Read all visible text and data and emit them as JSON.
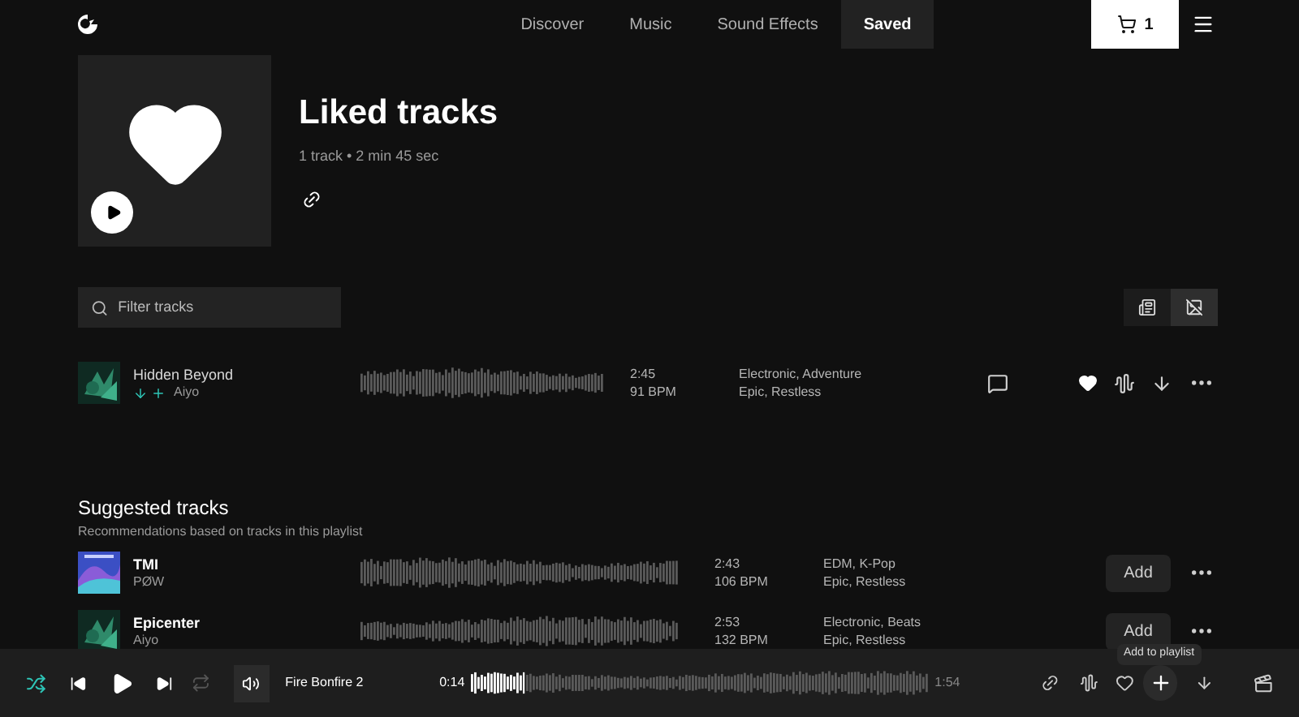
{
  "nav": {
    "items": [
      {
        "label": "Discover",
        "selected": false
      },
      {
        "label": "Music",
        "selected": false
      },
      {
        "label": "Sound Effects",
        "selected": false
      },
      {
        "label": "Saved",
        "selected": true
      }
    ],
    "cart_count": "1"
  },
  "playlist": {
    "title": "Liked tracks",
    "meta": "1 track • 2 min 45 sec"
  },
  "filter": {
    "placeholder": "Filter tracks"
  },
  "view_toggles": [
    {
      "selected": false
    },
    {
      "selected": true
    }
  ],
  "tracks": [
    {
      "title": "Hidden Beyond",
      "artist": "Aiyo",
      "duration": "2:45",
      "bpm": "91 BPM",
      "genres": "Electronic, Adventure",
      "moods": "Epic, Restless",
      "liked": true
    }
  ],
  "suggested": {
    "title": "Suggested tracks",
    "subtitle": "Recommendations based on tracks in this playlist",
    "tracks": [
      {
        "title": "TMI",
        "artist": "PØW",
        "duration": "2:43",
        "bpm": "106 BPM",
        "genres": "EDM, K-Pop",
        "moods": "Epic, Restless",
        "button": "Add"
      },
      {
        "title": "Epicenter",
        "artist": "Aiyo",
        "duration": "2:53",
        "bpm": "132 BPM",
        "genres": "Electronic, Beats",
        "moods": "Epic, Restless",
        "button": "Add"
      }
    ]
  },
  "tooltip": "Add to playlist",
  "player": {
    "title": "Fire Bonfire 2",
    "elapsed": "0:14",
    "total": "1:54",
    "level": 0.12,
    "shuffle": true,
    "repeat": false,
    "liked": false
  }
}
